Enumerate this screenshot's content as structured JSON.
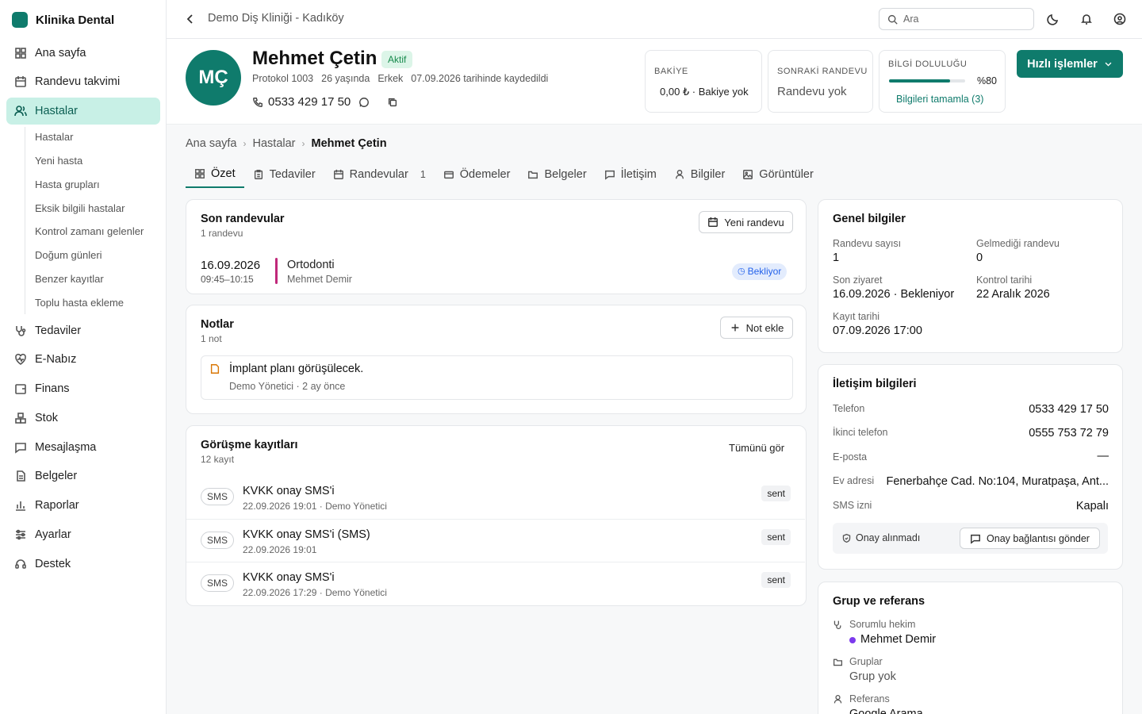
{
  "app": {
    "name": "Klinika Dental",
    "clinic": "Demo Diş Kliniği - Kadıköy"
  },
  "colors": {
    "brand": "#0f7b6c",
    "active_bg": "#c8f0e6",
    "accent_line": "#c0287a",
    "status_info": "#2563eb",
    "doctor_dot": "#7c3aed"
  },
  "sidebar": {
    "items": [
      {
        "label": "Ana sayfa",
        "icon": "grid-icon"
      },
      {
        "label": "Randevu takvimi",
        "icon": "calendar-icon"
      },
      {
        "label": "Hastalar",
        "icon": "users-icon"
      },
      {
        "label": "Tedaviler",
        "icon": "stethoscope-icon"
      },
      {
        "label": "E-Nabız",
        "icon": "heartbeat-icon"
      },
      {
        "label": "Finans",
        "icon": "wallet-icon"
      },
      {
        "label": "Stok",
        "icon": "boxes-icon"
      },
      {
        "label": "Mesajlaşma",
        "icon": "message-icon"
      },
      {
        "label": "Belgeler",
        "icon": "file-icon"
      },
      {
        "label": "Raporlar",
        "icon": "chart-icon"
      },
      {
        "label": "Ayarlar",
        "icon": "sliders-icon"
      },
      {
        "label": "Destek",
        "icon": "headset-icon"
      }
    ],
    "subitems": [
      "Hastalar",
      "Yeni hasta",
      "Hasta grupları",
      "Eksik bilgili hastalar",
      "Kontrol zamanı gelenler",
      "Doğum günleri",
      "Benzer kayıtlar",
      "Toplu hasta ekleme"
    ]
  },
  "search": {
    "placeholder": "Ara"
  },
  "patient": {
    "initials": "MÇ",
    "name": "Mehmet Çetin",
    "status": "Aktif",
    "protocol": "Protokol 1003",
    "age": "26 yaşında",
    "gender": "Erkek",
    "registered": "07.09.2026 tarihinde kaydedildi",
    "phone": "0533 429 17 50"
  },
  "stats": {
    "balance_label": "BAKİYE",
    "balance_value": "0,00 ₺ · Bakiye yok",
    "next_label": "SONRAKİ RANDEVU",
    "next_value": "Randevu yok",
    "fill_label": "BİLGİ DOLULUĞU",
    "fill_percent_text": "%80",
    "fill_value": 0.8,
    "fill_link": "Bilgileri tamamla (3)"
  },
  "quick_actions": "Hızlı işlemler",
  "breadcrumb": [
    "Ana sayfa",
    "Hastalar",
    "Mehmet Çetin"
  ],
  "tabs": [
    {
      "label": "Özet",
      "icon": "grid-icon"
    },
    {
      "label": "Tedaviler",
      "icon": "clipboard-icon"
    },
    {
      "label": "Randevular",
      "icon": "calendar-icon",
      "count": "1"
    },
    {
      "label": "Ödemeler",
      "icon": "card-icon"
    },
    {
      "label": "Belgeler",
      "icon": "folder-icon"
    },
    {
      "label": "İletişim",
      "icon": "message-icon"
    },
    {
      "label": "Bilgiler",
      "icon": "user-icon"
    },
    {
      "label": "Görüntüler",
      "icon": "image-icon"
    }
  ],
  "appointments": {
    "title": "Son randevular",
    "subtitle": "1 randevu",
    "button": "Yeni randevu",
    "items": [
      {
        "date": "16.09.2026",
        "time": "09:45–10:15",
        "type": "Ortodonti",
        "doctor": "Mehmet Demir",
        "status": "Bekliyor"
      }
    ]
  },
  "notes": {
    "title": "Notlar",
    "subtitle": "1 not",
    "button": "Not ekle",
    "items": [
      {
        "text": "İmplant planı görüşülecek.",
        "meta": "Demo Yönetici · 2 ay önce"
      }
    ]
  },
  "logs": {
    "title": "Görüşme kayıtları",
    "subtitle": "12 kayıt",
    "link": "Tümünü gör",
    "items": [
      {
        "channel": "SMS",
        "title": "KVKK onay SMS'i",
        "meta": "22.09.2026 19:01 · Demo Yönetici",
        "status": "sent"
      },
      {
        "channel": "SMS",
        "title": "KVKK onay SMS'i (SMS)",
        "meta": "22.09.2026 19:01",
        "status": "sent"
      },
      {
        "channel": "SMS",
        "title": "KVKK onay SMS'i",
        "meta": "22.09.2026 17:29 · Demo Yönetici",
        "status": "sent"
      }
    ]
  },
  "general": {
    "title": "Genel bilgiler",
    "appt_count_label": "Randevu sayısı",
    "appt_count": "1",
    "missed_label": "Gelmediği randevu",
    "missed": "0",
    "last_visit_label": "Son ziyaret",
    "last_visit": "16.09.2026 · Bekleniyor",
    "control_label": "Kontrol tarihi",
    "control": "22 Aralık 2026",
    "reg_label": "Kayıt tarihi",
    "reg": "07.09.2026 17:00"
  },
  "contact": {
    "title": "İletişim bilgileri",
    "phone_label": "Telefon",
    "phone": "0533 429 17 50",
    "phone2_label": "İkinci telefon",
    "phone2": "0555 753 72 79",
    "email_label": "E-posta",
    "email": "—",
    "address_label": "Ev adresi",
    "address": "Fenerbahçe Cad. No:104, Muratpaşa, Ant...",
    "sms_label": "SMS izni",
    "sms": "Kapalı",
    "consent_status": "Onay alınmadı",
    "consent_button": "Onay bağlantısı gönder"
  },
  "group": {
    "title": "Grup ve referans",
    "doctor_label": "Sorumlu hekim",
    "doctor": "Mehmet Demir",
    "groups_label": "Gruplar",
    "groups": "Grup yok",
    "ref_label": "Referans",
    "ref": "Google Arama"
  }
}
